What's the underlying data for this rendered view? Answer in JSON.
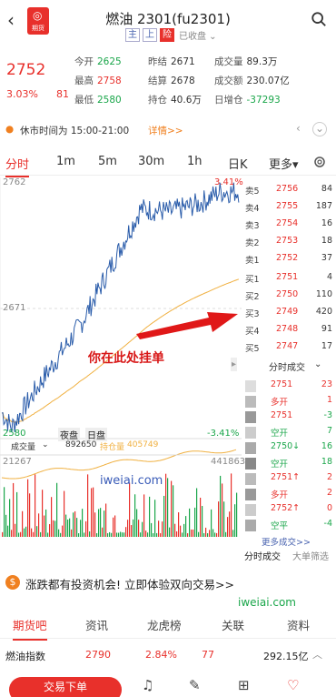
{
  "header": {
    "title": "燃油 2301(fu2301)",
    "logo_text": "期货",
    "tags": [
      "主",
      "上",
      "险"
    ],
    "collect": "已收盘"
  },
  "quote": {
    "price": "2752",
    "pct": "3.03%",
    "chg": "81",
    "stats": [
      {
        "label": "今开",
        "value": "2625",
        "color": "#1aa64a"
      },
      {
        "label": "昨结",
        "value": "2671",
        "color": "#333"
      },
      {
        "label": "成交量",
        "value": "89.3万",
        "color": "#333"
      },
      {
        "label": "最高",
        "value": "2758",
        "color": "#e8302b"
      },
      {
        "label": "结算",
        "value": "2678",
        "color": "#333"
      },
      {
        "label": "成交额",
        "value": "230.07亿",
        "color": "#333"
      },
      {
        "label": "最低",
        "value": "2580",
        "color": "#1aa64a"
      },
      {
        "label": "持仓",
        "value": "40.6万",
        "color": "#333"
      },
      {
        "label": "日增仓",
        "value": "-37293",
        "color": "#1aa64a"
      }
    ]
  },
  "notice": {
    "text": "休市时间为 15:00-21:00",
    "detail": "详情>>"
  },
  "tabs": [
    "分时",
    "1m",
    "5m",
    "30m",
    "1h",
    "日K",
    "更多"
  ],
  "chart": {
    "y_top": "2762",
    "y_mid": "2671",
    "y_bottom": "2580",
    "pct_top": "3.41%",
    "pct_bottom": "-3.41%",
    "night_label": "夜盘",
    "day_label": "日盘",
    "vol_label": "成交量",
    "vol_value": "892650",
    "hold_label": "持仓量",
    "hold_value": "405749",
    "vol_max": "21267",
    "hold_max": "441863",
    "annotation": "你在此处挂单",
    "watermark": "iweiai.com"
  },
  "orderbook": {
    "asks": [
      {
        "label": "卖5",
        "price": "2756",
        "vol": "84"
      },
      {
        "label": "卖4",
        "price": "2755",
        "vol": "187"
      },
      {
        "label": "卖3",
        "price": "2754",
        "vol": "16"
      },
      {
        "label": "卖2",
        "price": "2753",
        "vol": "18"
      },
      {
        "label": "卖1",
        "price": "2752",
        "vol": "37"
      }
    ],
    "bids": [
      {
        "label": "买1",
        "price": "2751",
        "vol": "4"
      },
      {
        "label": "买2",
        "price": "2750",
        "vol": "110"
      },
      {
        "label": "买3",
        "price": "2749",
        "vol": "420"
      },
      {
        "label": "买4",
        "price": "2748",
        "vol": "91"
      },
      {
        "label": "买5",
        "price": "2747",
        "vol": "17"
      }
    ],
    "trades_title": "分时成交",
    "trades": [
      {
        "a": "2751",
        "b": "23",
        "ca": "#e8302b",
        "cb": "#e8302b"
      },
      {
        "a": "多开",
        "b": "1",
        "ca": "#e8302b",
        "cb": "#e8302b"
      },
      {
        "a": "2751",
        "b": "-3",
        "ca": "#e8302b",
        "cb": "#1aa64a"
      },
      {
        "a": "空开",
        "b": "7",
        "ca": "#1aa64a",
        "cb": "#1aa64a"
      },
      {
        "a": "2750↓",
        "b": "16",
        "ca": "#1aa64a",
        "cb": "#1aa64a"
      },
      {
        "a": "空开",
        "b": "18",
        "ca": "#1aa64a",
        "cb": "#1aa64a"
      },
      {
        "a": "2751↑",
        "b": "2",
        "ca": "#e8302b",
        "cb": "#e8302b"
      },
      {
        "a": "多开",
        "b": "2",
        "ca": "#e8302b",
        "cb": "#e8302b"
      },
      {
        "a": "2752↑",
        "b": "0",
        "ca": "#e8302b",
        "cb": "#e8302b"
      },
      {
        "a": "空平",
        "b": "-4",
        "ca": "#1aa64a",
        "cb": "#1aa64a"
      }
    ],
    "more_trades": "更多成交>>",
    "sub_tab1": "分时成交",
    "sub_tab2": "大单筛选"
  },
  "ad": {
    "text": "涨跌都有投资机会! 立即体验双向交易>>",
    "watermark": "iweiai.com"
  },
  "bottom_tabs": [
    "期货吧",
    "资讯",
    "龙虎榜",
    "关联",
    "资料"
  ],
  "index_row": {
    "name": "燃油指数",
    "value": "2790",
    "pct": "2.84%",
    "chg": "77",
    "extra": "292.15亿"
  },
  "trade_button": "交易下单"
}
